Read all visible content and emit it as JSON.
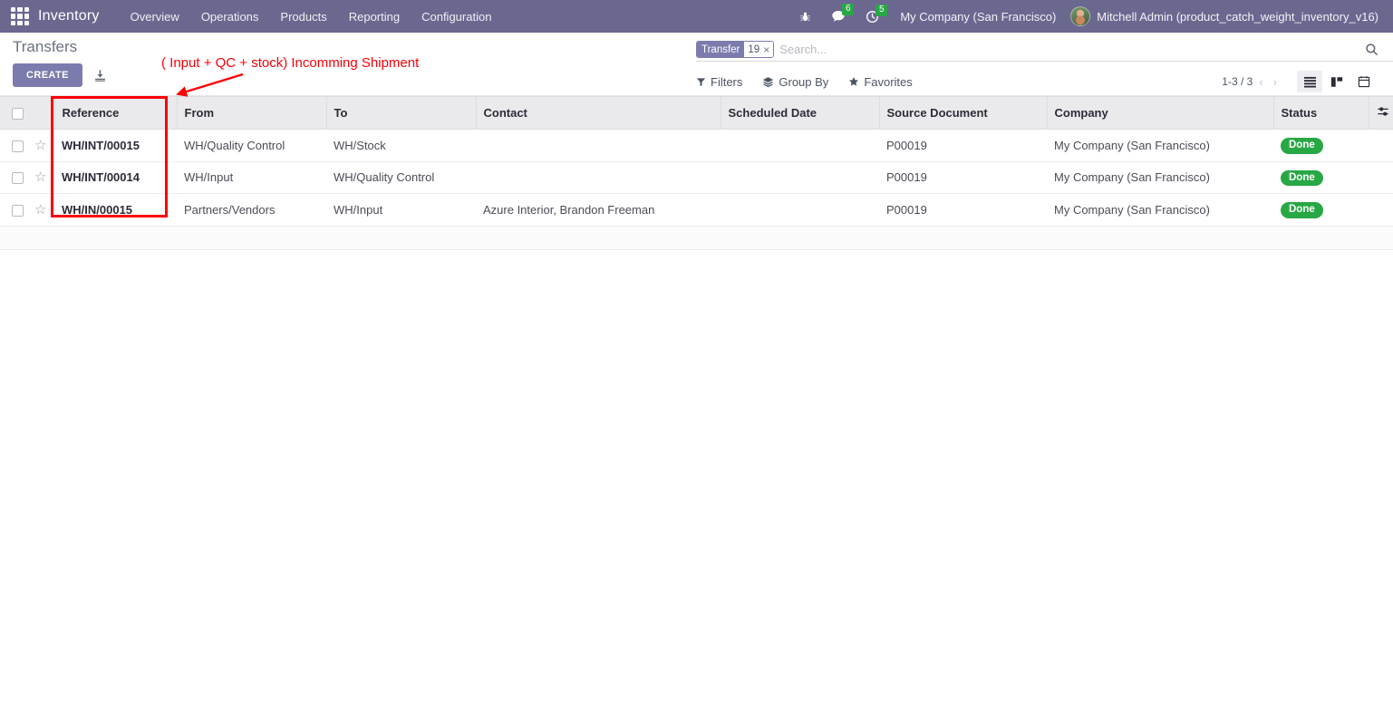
{
  "navbar": {
    "apps_icon": "apps-grid-icon",
    "brand": "Inventory",
    "menus": [
      "Overview",
      "Operations",
      "Products",
      "Reporting",
      "Configuration"
    ],
    "sys_icons": [
      {
        "name": "bug-icon",
        "glyph": "debug",
        "badge": null
      },
      {
        "name": "messages-icon",
        "glyph": "chat",
        "badge": "6"
      },
      {
        "name": "activities-icon",
        "glyph": "clock",
        "badge": "5"
      }
    ],
    "company": "My Company (San Francisco)",
    "user": "Mitchell Admin (product_catch_weight_inventory_v16)"
  },
  "control_panel": {
    "breadcrumb": "Transfers",
    "create_label": "CREATE",
    "import_icon": "import-download-icon",
    "search": {
      "facet_label": "Transfer",
      "facet_value": "19",
      "facet_remove": "×",
      "placeholder": "Search...",
      "value": "",
      "search_icon": "search-icon"
    },
    "filters": [
      {
        "name": "filters",
        "label": "Filters",
        "icon": "funnel-icon"
      },
      {
        "name": "group-by",
        "label": "Group By",
        "icon": "layers-icon"
      },
      {
        "name": "favorites",
        "label": "Favorites",
        "icon": "star-icon"
      }
    ],
    "pager": {
      "range": "1-3 / 3",
      "prev": "‹",
      "next": "›"
    },
    "views": [
      {
        "name": "list-view",
        "icon": "list-icon",
        "active": true
      },
      {
        "name": "kanban-view",
        "icon": "kanban-icon",
        "active": false
      },
      {
        "name": "calendar-view",
        "icon": "calendar-icon",
        "active": false
      }
    ]
  },
  "table": {
    "columns": [
      "Reference",
      "From",
      "To",
      "Contact",
      "Scheduled Date",
      "Source Document",
      "Company",
      "Status"
    ],
    "optional_columns_icon": "sliders-icon",
    "rows": [
      {
        "reference": "WH/INT/00015",
        "from": "WH/Quality Control",
        "to": "WH/Stock",
        "contact": "",
        "scheduled_date": "",
        "source_document": "P00019",
        "company": "My Company (San Francisco)",
        "status": "Done"
      },
      {
        "reference": "WH/INT/00014",
        "from": "WH/Input",
        "to": "WH/Quality Control",
        "contact": "",
        "scheduled_date": "",
        "source_document": "P00019",
        "company": "My Company (San Francisco)",
        "status": "Done"
      },
      {
        "reference": "WH/IN/00015",
        "from": "Partners/Vendors",
        "to": "WH/Input",
        "contact": "Azure Interior, Brandon Freeman",
        "scheduled_date": "",
        "source_document": "P00019",
        "company": "My Company (San Francisco)",
        "status": "Done"
      }
    ]
  },
  "annotation": {
    "text": "( Input + QC + stock) Incomming Shipment",
    "color": "#fb0007",
    "highlight_target": "reference-column"
  },
  "colors": {
    "navbar_bg": "#6b6890",
    "brand_purple": "#7c7bad",
    "status_done": "#28a745",
    "annotation_red": "#fb0007",
    "header_bg": "#eaeaed"
  }
}
